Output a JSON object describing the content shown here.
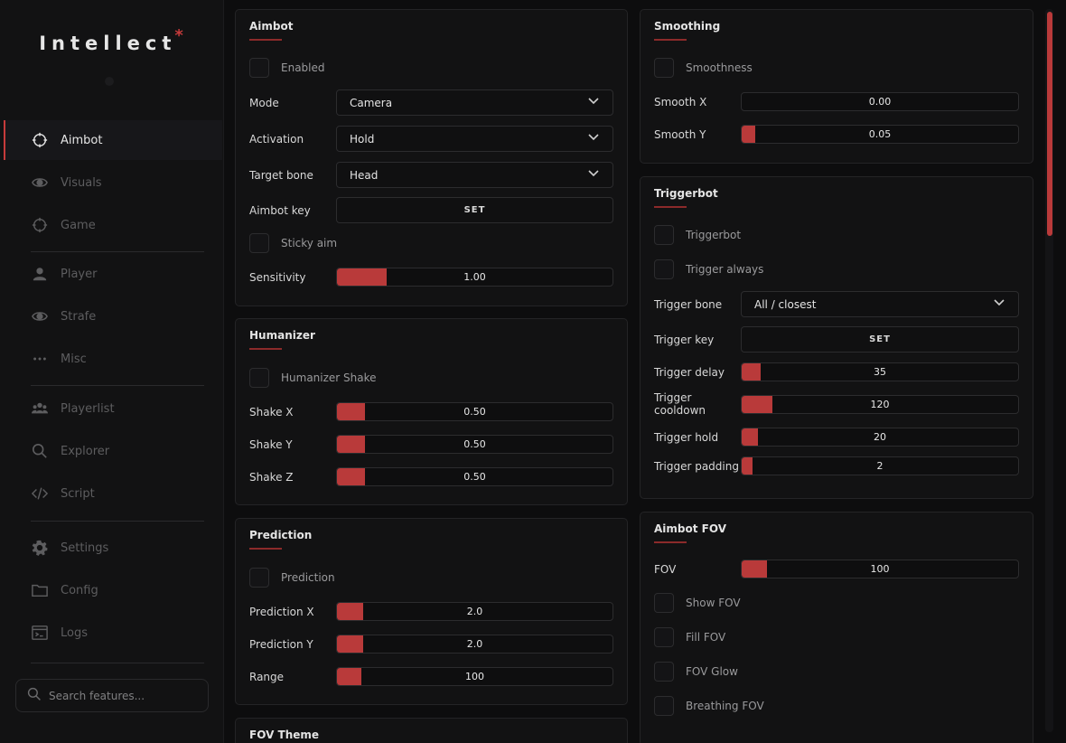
{
  "app": {
    "name": "Intellect",
    "star": "*"
  },
  "sidebar": {
    "items": [
      {
        "label": "Aimbot",
        "icon": "crosshair-icon"
      },
      {
        "label": "Visuals",
        "icon": "eye-icon"
      },
      {
        "label": "Game",
        "icon": "crosshair-icon"
      },
      {
        "label": "Player",
        "icon": "user-icon"
      },
      {
        "label": "Strafe",
        "icon": "eye-icon"
      },
      {
        "label": "Misc",
        "icon": "dots-icon"
      },
      {
        "label": "Playerlist",
        "icon": "users-icon"
      },
      {
        "label": "Explorer",
        "icon": "search-icon"
      },
      {
        "label": "Script",
        "icon": "code-icon"
      },
      {
        "label": "Settings",
        "icon": "gear-icon"
      },
      {
        "label": "Config",
        "icon": "folder-icon"
      },
      {
        "label": "Logs",
        "icon": "terminal-icon"
      }
    ],
    "search_placeholder": "Search features..."
  },
  "aimbot": {
    "title": "Aimbot",
    "enabled_label": "Enabled",
    "mode_label": "Mode",
    "mode_value": "Camera",
    "activation_label": "Activation",
    "activation_value": "Hold",
    "target_bone_label": "Target bone",
    "target_bone_value": "Head",
    "key_label": "Aimbot key",
    "key_value": "SET",
    "sticky_label": "Sticky aim",
    "sensitivity_label": "Sensitivity",
    "sensitivity_value": "1.00",
    "sensitivity_fill": 0.18
  },
  "humanizer": {
    "title": "Humanizer",
    "shake_label": "Humanizer Shake",
    "shake_x_label": "Shake X",
    "shake_x_value": "0.50",
    "shake_x_fill": 0.1,
    "shake_y_label": "Shake Y",
    "shake_y_value": "0.50",
    "shake_y_fill": 0.1,
    "shake_z_label": "Shake Z",
    "shake_z_value": "0.50",
    "shake_z_fill": 0.1
  },
  "prediction": {
    "title": "Prediction",
    "prediction_label": "Prediction",
    "x_label": "Prediction X",
    "x_value": "2.0",
    "x_fill": 0.095,
    "y_label": "Prediction Y",
    "y_value": "2.0",
    "y_fill": 0.095,
    "range_label": "Range",
    "range_value": "100",
    "range_fill": 0.09
  },
  "fov_theme": {
    "title": "FOV Theme"
  },
  "smoothing": {
    "title": "Smoothing",
    "smoothness_label": "Smoothness",
    "x_label": "Smooth X",
    "x_value": "0.00",
    "x_fill": 0,
    "y_label": "Smooth Y",
    "y_value": "0.05",
    "y_fill": 0.05
  },
  "triggerbot": {
    "title": "Triggerbot",
    "trigger_label": "Triggerbot",
    "always_label": "Trigger always",
    "bone_label": "Trigger bone",
    "bone_value": "All / closest",
    "key_label": "Trigger key",
    "key_value": "SET",
    "delay_label": "Trigger delay",
    "delay_value": "35",
    "delay_fill": 0.07,
    "cooldown_label": "Trigger cooldown",
    "cooldown_value": "120",
    "cooldown_fill": 0.11,
    "hold_label": "Trigger hold",
    "hold_value": "20",
    "hold_fill": 0.06,
    "padding_label": "Trigger padding",
    "padding_value": "2",
    "padding_fill": 0.04
  },
  "aimbot_fov": {
    "title": "Aimbot FOV",
    "fov_label": "FOV",
    "fov_value": "100",
    "fov_fill": 0.09,
    "show_label": "Show FOV",
    "fill_label": "Fill FOV",
    "glow_label": "FOV Glow",
    "breathing_label": "Breathing FOV"
  },
  "colors": {
    "accent": "#b93a3a",
    "background": "#0d0d0e",
    "panel": "#121213"
  }
}
